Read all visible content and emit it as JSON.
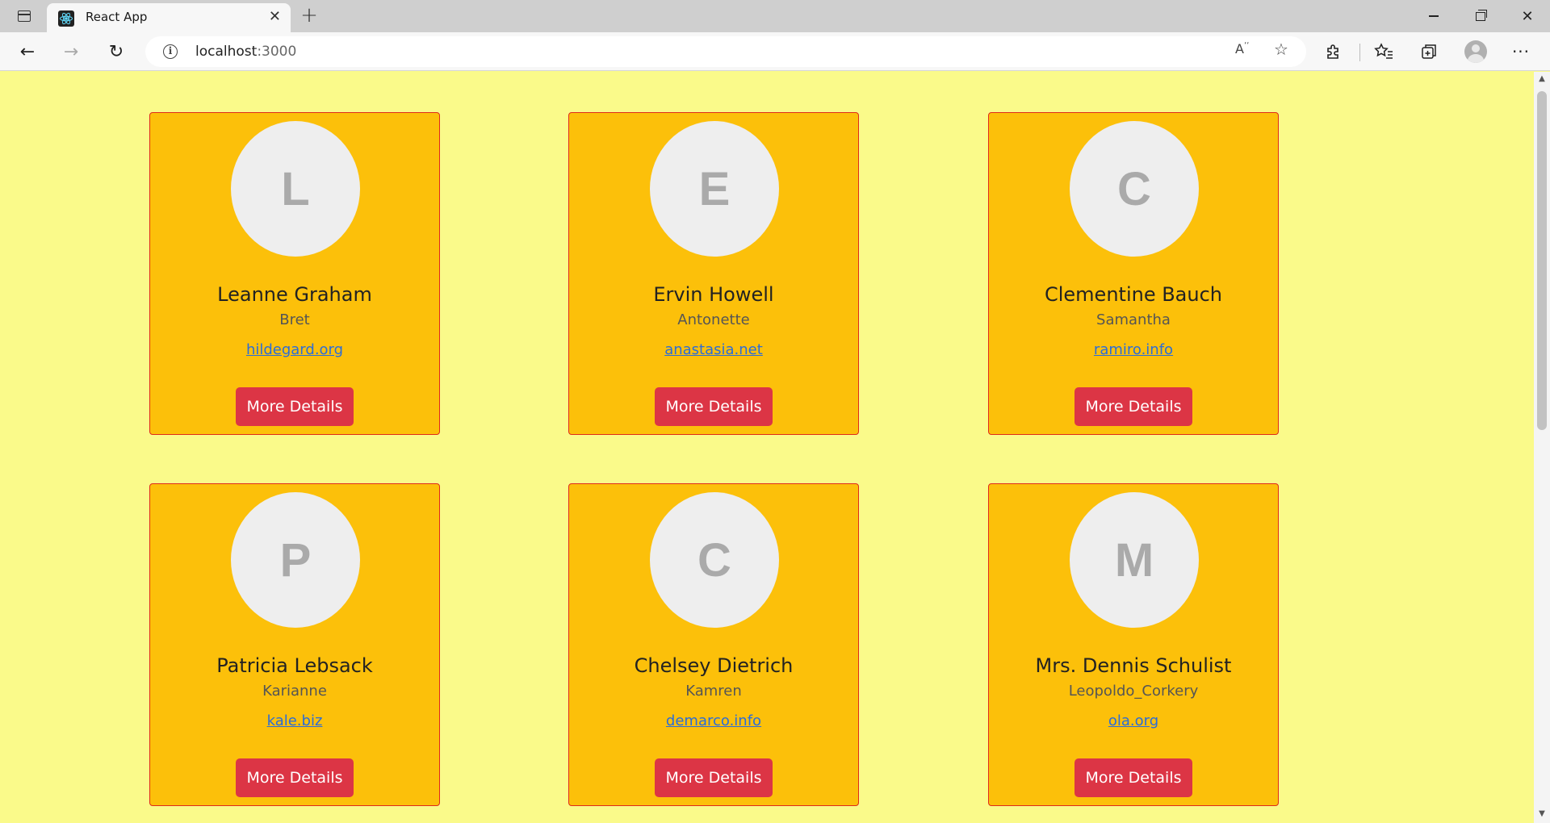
{
  "browser": {
    "tab_title": "React App",
    "tab_close": "✕",
    "new_tab": "+",
    "url_host": "localhost",
    "url_port": ":3000",
    "controls": {
      "minimize": "",
      "maximize": "",
      "close": "✕"
    }
  },
  "users": [
    {
      "initial": "L",
      "name": "Leanne Graham",
      "username": "Bret",
      "website": "hildegard.org",
      "button": "More Details"
    },
    {
      "initial": "E",
      "name": "Ervin Howell",
      "username": "Antonette",
      "website": "anastasia.net",
      "button": "More Details"
    },
    {
      "initial": "C",
      "name": "Clementine Bauch",
      "username": "Samantha",
      "website": "ramiro.info",
      "button": "More Details"
    },
    {
      "initial": "P",
      "name": "Patricia Lebsack",
      "username": "Karianne",
      "website": "kale.biz",
      "button": "More Details"
    },
    {
      "initial": "C",
      "name": "Chelsey Dietrich",
      "username": "Kamren",
      "website": "demarco.info",
      "button": "More Details"
    },
    {
      "initial": "M",
      "name": "Mrs. Dennis Schulist",
      "username": "Leopoldo_Corkery",
      "website": "ola.org",
      "button": "More Details"
    }
  ],
  "colors": {
    "page_background": "#fafa8a",
    "card_background": "#fcc00a",
    "card_border": "#e02a1a",
    "button": "#dc3545",
    "link": "#2b6cd8"
  }
}
